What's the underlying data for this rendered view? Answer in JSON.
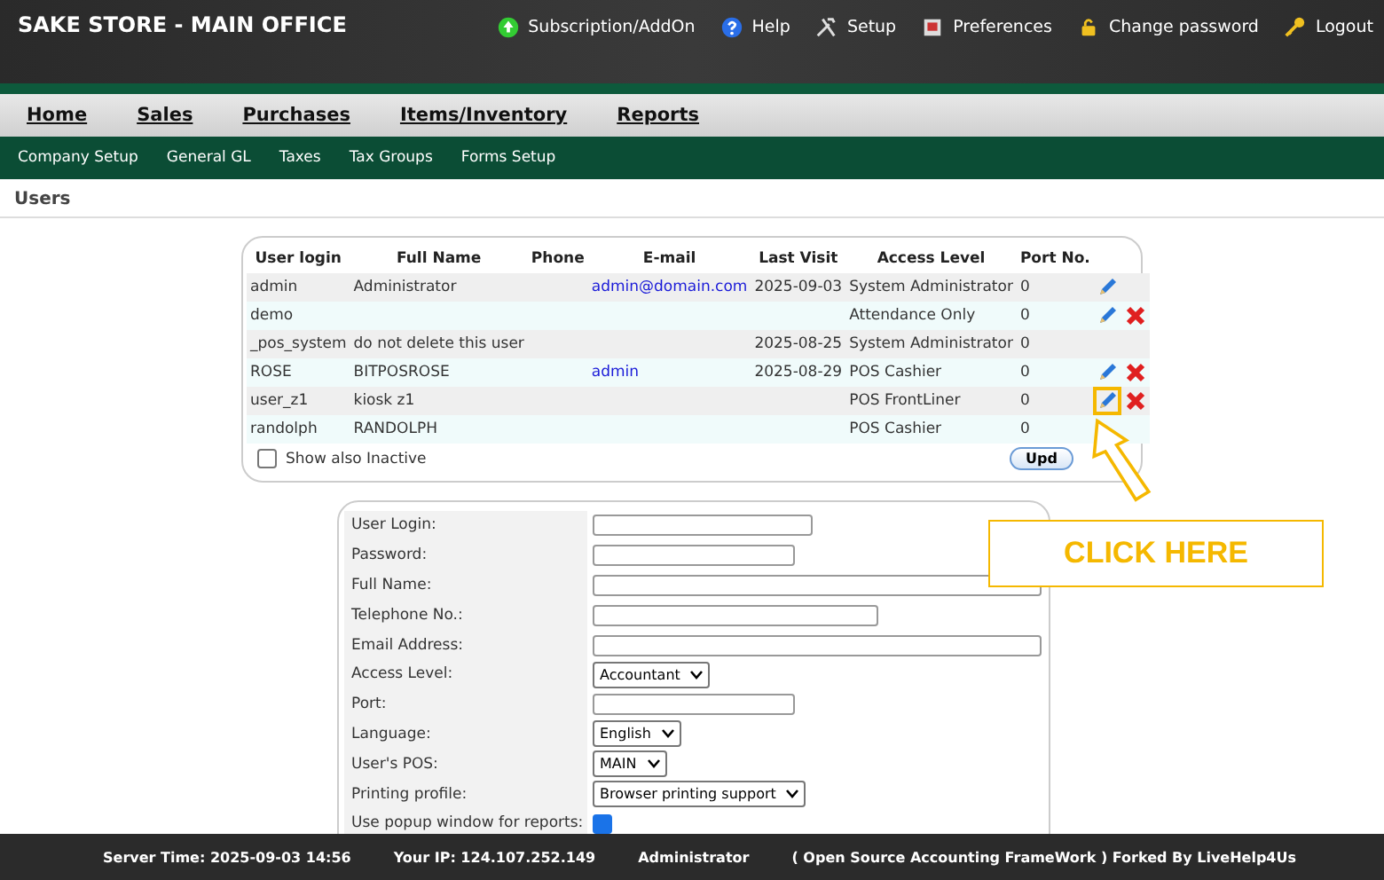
{
  "header": {
    "title": "SAKE STORE - MAIN OFFICE",
    "links": [
      {
        "kind": "addon",
        "label": "Subscription/AddOn"
      },
      {
        "kind": "help",
        "label": "Help"
      },
      {
        "kind": "setup",
        "label": "Setup"
      },
      {
        "kind": "preferences",
        "label": "Preferences"
      },
      {
        "kind": "lock",
        "label": "Change password"
      },
      {
        "kind": "key",
        "label": "Logout"
      }
    ]
  },
  "main_menu": [
    {
      "label": "Home"
    },
    {
      "label": "Sales"
    },
    {
      "label": "Purchases"
    },
    {
      "label": "Items/Inventory"
    },
    {
      "label": "Reports"
    }
  ],
  "sub_menu": [
    {
      "label": "Company Setup"
    },
    {
      "label": "General GL"
    },
    {
      "label": "Taxes"
    },
    {
      "label": "Tax Groups"
    },
    {
      "label": "Forms Setup"
    }
  ],
  "page_title": "Users",
  "table": {
    "columns": [
      "User login",
      "Full Name",
      "Phone",
      "E-mail",
      "Last Visit",
      "Access Level",
      "Port No."
    ],
    "rows": [
      {
        "login": "admin",
        "full_name": "Administrator",
        "phone": "",
        "email": "admin@domain.com",
        "last_visit": "2025-09-03",
        "access_level": "System Administrator",
        "port": "0",
        "edit": true,
        "delete": false,
        "highlighted": false
      },
      {
        "login": "demo",
        "full_name": "",
        "phone": "",
        "email": "",
        "last_visit": "",
        "access_level": "Attendance Only",
        "port": "0",
        "edit": true,
        "delete": true,
        "highlighted": false
      },
      {
        "login": "_pos_system",
        "full_name": "do not delete this user",
        "phone": "",
        "email": "",
        "last_visit": "2025-08-25",
        "access_level": "System Administrator",
        "port": "0",
        "edit": false,
        "delete": false,
        "highlighted": false
      },
      {
        "login": "ROSE",
        "full_name": "BITPOSROSE",
        "phone": "",
        "email": "admin",
        "last_visit": "2025-08-29",
        "access_level": "POS Cashier",
        "port": "0",
        "edit": true,
        "delete": true,
        "highlighted": false
      },
      {
        "login": "user_z1",
        "full_name": "kiosk z1",
        "phone": "",
        "email": "",
        "last_visit": "",
        "access_level": "POS FrontLiner",
        "port": "0",
        "edit": true,
        "delete": true,
        "highlighted": true
      },
      {
        "login": "randolph",
        "full_name": "RANDOLPH",
        "phone": "",
        "email": "",
        "last_visit": "",
        "access_level": "POS Cashier",
        "port": "0",
        "edit": false,
        "delete": false,
        "highlighted": false
      }
    ],
    "show_inactive": {
      "label": "Show also Inactive",
      "checked": false
    },
    "update_button": "Upd"
  },
  "form": [
    {
      "kind": "text",
      "label": "User Login:"
    },
    {
      "kind": "text",
      "label": "Password:"
    },
    {
      "kind": "text",
      "label": "Full Name:"
    },
    {
      "kind": "text",
      "label": "Telephone No.:"
    },
    {
      "kind": "text",
      "label": "Email Address:"
    },
    {
      "kind": "select",
      "label": "Access Level:",
      "value": "Accountant"
    },
    {
      "kind": "text",
      "label": "Port:"
    },
    {
      "kind": "select",
      "label": "Language:",
      "value": "English"
    },
    {
      "kind": "select",
      "label": "User's POS:",
      "value": "MAIN"
    },
    {
      "kind": "select",
      "label": "Printing profile:",
      "value": "Browser printing support"
    },
    {
      "kind": "checkbox",
      "label": "Use popup window for reports:",
      "checked": true
    }
  ],
  "callout": {
    "label": "CLICK HERE"
  },
  "footer": [
    "Server Time: 2025-09-03 14:56",
    "Your IP: 124.107.252.149",
    "Administrator",
    "( Open Source Accounting FrameWork ) Forked By LiveHelp4Us"
  ]
}
